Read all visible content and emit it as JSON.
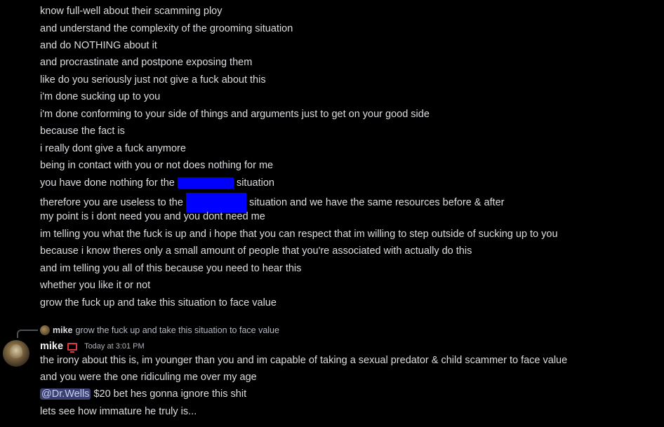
{
  "messages_top": [
    {
      "text": "know full-well about their scamming ploy"
    },
    {
      "text": "and understand the complexity of the grooming situation"
    },
    {
      "text": "and do NOTHING about it"
    },
    {
      "text": "and procrastinate and postpone exposing them"
    },
    {
      "text": "like do you seriously just not give a fuck about this"
    },
    {
      "text": "i'm done sucking up to you"
    },
    {
      "text": "i'm done conforming to your side of things and arguments just to get on your good side"
    },
    {
      "text": "because the fact is"
    },
    {
      "text": "i really dont give a fuck anymore"
    },
    {
      "text": "being in contact with you or not does nothing for me"
    },
    {
      "before": "you have done nothing for the",
      "after": "situation"
    },
    {
      "before": "therefore you are useless to the",
      "after": "situation and we have the same resources before & after"
    },
    {
      "text": "my point is i dont need you and you dont need me"
    },
    {
      "text": "im telling you what the fuck is up and i hope that you can respect that im willing to step outside of sucking up to you"
    },
    {
      "text": "because i know theres only a small amount of people that you're associated with actually do this"
    },
    {
      "text": "and im telling you all of this because you need to hear this"
    },
    {
      "text": "whether you like it or not"
    },
    {
      "text": "grow the fuck up and take this situation to face value"
    }
  ],
  "reply": {
    "author": "mike",
    "text": "grow the fuck up and take this situation to face value"
  },
  "post": {
    "author": "mike",
    "timestamp": "Today at 3:01 PM",
    "line1": "the irony about this is, im younger than you and im capable of taking a sexual predator & child scammer to face value",
    "line2": "and you were the one ridiculing me over my age",
    "mention": "@Dr.Wells",
    "line3_rest": " $20 bet hes gonna ignore this shit",
    "line4": "lets see how immature he truly is..."
  },
  "colors": {
    "background": "#000000",
    "text": "#dcdde1",
    "redaction": "#0000ff",
    "mention_bg": "#3c4270",
    "mention_text": "#c9cdfb",
    "badge": "#e0363c"
  }
}
